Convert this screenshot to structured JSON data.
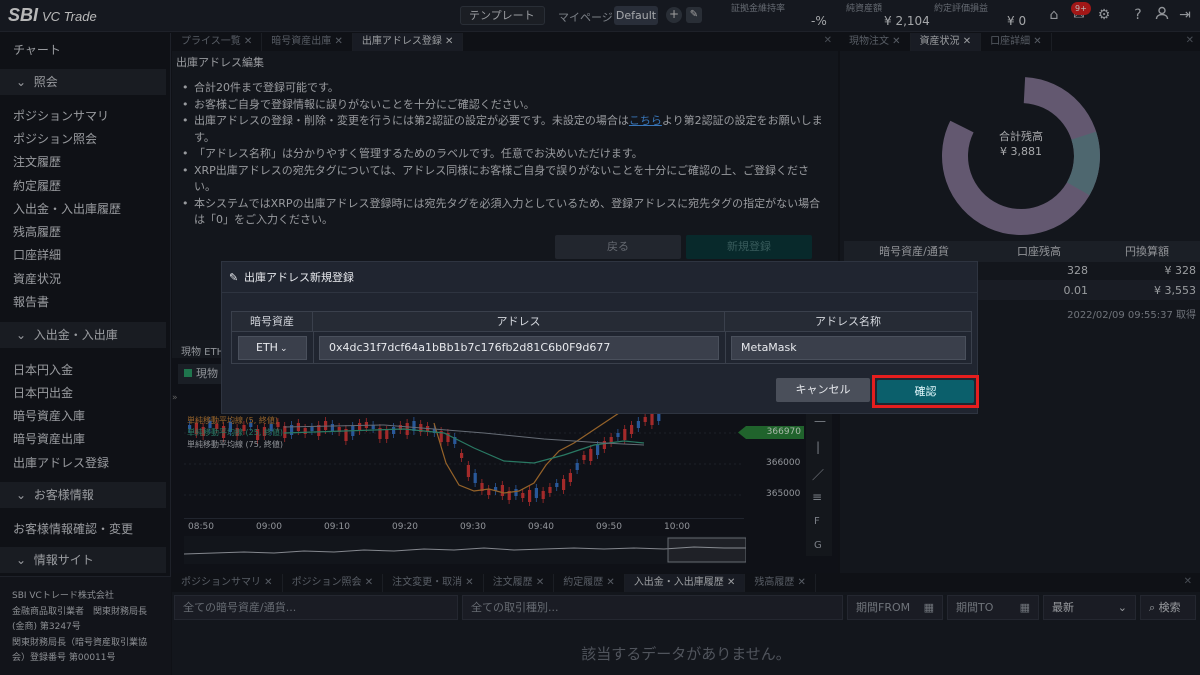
{
  "header": {
    "logo_sbi": "SBI",
    "logo_vc": "VC Trade",
    "template_label": "テンプレート",
    "mypage_label": "マイページ:",
    "mypage_value": "Default",
    "stats": [
      {
        "label": "証拠金維持率",
        "value": "-%"
      },
      {
        "label": "純資産額",
        "value": "¥ 2,104"
      },
      {
        "label": "約定評価損益",
        "value": "¥ 0"
      }
    ],
    "notification_badge": "9+"
  },
  "sidebar": {
    "top_item": "チャート",
    "sections": [
      {
        "title": "照会",
        "items": [
          "ポジションサマリ",
          "ポジション照会",
          "注文履歴",
          "約定履歴",
          "入出金・入出庫履歴",
          "残高履歴",
          "口座詳細",
          "資産状況",
          "報告書"
        ]
      },
      {
        "title": "入出金・入出庫",
        "items": [
          "日本円入金",
          "日本円出金",
          "暗号資産入庫",
          "暗号資産出庫",
          "出庫アドレス登録"
        ]
      },
      {
        "title": "お客様情報",
        "items": [
          "お客様情報確認・変更"
        ]
      },
      {
        "title": "情報サイト",
        "items": []
      }
    ],
    "footer": [
      "SBI VCトレード株式会社",
      "金融商品取引業者　関東財務局長",
      "(金商) 第3247号",
      "関東財務局長（暗号資産取引業協",
      "会）登録番号 第00011号"
    ]
  },
  "center": {
    "tabs": [
      "プライス一覧",
      "暗号資産出庫",
      "出庫アドレス登録"
    ],
    "title": "出庫アドレス編集",
    "bullets": [
      "合計20件まで登録可能です。",
      "お客様ご自身で登録情報に誤りがないことを十分にご確認ください。",
      "出庫アドレスの登録・削除・変更を行うには第2認証の設定が必要です。未設定の場合は",
      "「アドレス名称」は分かりやすく管理するためのラベルです。任意でお決めいただけます。",
      "XRP出庫アドレスの宛先タグについては、アドレス同様にお客様ご自身で誤りがないことを十分にご確認の上、ご登録ください。",
      "本システムではXRPの出庫アドレス登録時には宛先タグを必須入力としているため、登録アドレスに宛先タグの指定がない場合は「0」をご入力ください。"
    ],
    "link_text": "こちら",
    "bullet3_tail": "より第2認証の設定をお願いします。",
    "back_button": "戻る",
    "new_button": "新規登録"
  },
  "right": {
    "tabs": [
      "現物注文",
      "資産状況",
      "口座詳細"
    ],
    "donut_label": "合計残高",
    "donut_value": "¥ 3,881",
    "table_headers": [
      "暗号資産/通貨",
      "口座残高",
      "円換算額"
    ],
    "rows": [
      {
        "balance": "328",
        "jpy": "¥ 328"
      },
      {
        "balance": "0.01",
        "jpy": "¥ 3,553"
      }
    ],
    "timestamp": "2022/02/09 09:55:37 取得",
    "colors": {
      "donut_main": "#8a7b9c",
      "donut_small": "#6d8f9a"
    }
  },
  "chart": {
    "title": "現物 ETH/",
    "legend_small": "現物",
    "ma_labels": [
      "単純移動平均線 (5, 終値)",
      "単純移動平均線 (25, 終値)",
      "単純移動平均線 (75, 終値)"
    ],
    "price_tag": "366970",
    "y_labels": [
      "366000",
      "365000"
    ],
    "x_labels": [
      "08:50",
      "09:00",
      "09:10",
      "09:20",
      "09:30",
      "09:40",
      "09:50",
      "10:00"
    ]
  },
  "bottom": {
    "tabs": [
      "ポジションサマリ",
      "ポジション照会",
      "注文変更・取消",
      "注文履歴",
      "約定履歴",
      "入出金・入出庫履歴",
      "残高履歴"
    ],
    "filters": {
      "asset_placeholder": "全ての暗号資産/通貨...",
      "type_placeholder": "全ての取引種別...",
      "from": "期間FROM",
      "to": "期間TO",
      "sort": "最新",
      "search": "検索"
    },
    "empty_message": "該当するデータがありません。"
  },
  "modal": {
    "title": "出庫アドレス新規登録",
    "headers": [
      "暗号資産",
      "アドレス",
      "アドレス名称"
    ],
    "asset_value": "ETH",
    "address_value": "0x4dc31f7dcf64a1bBb1b7c176fb2d81C6b0F9d677",
    "name_value": "MetaMask",
    "cancel_button": "キャンセル",
    "confirm_button": "確認"
  }
}
